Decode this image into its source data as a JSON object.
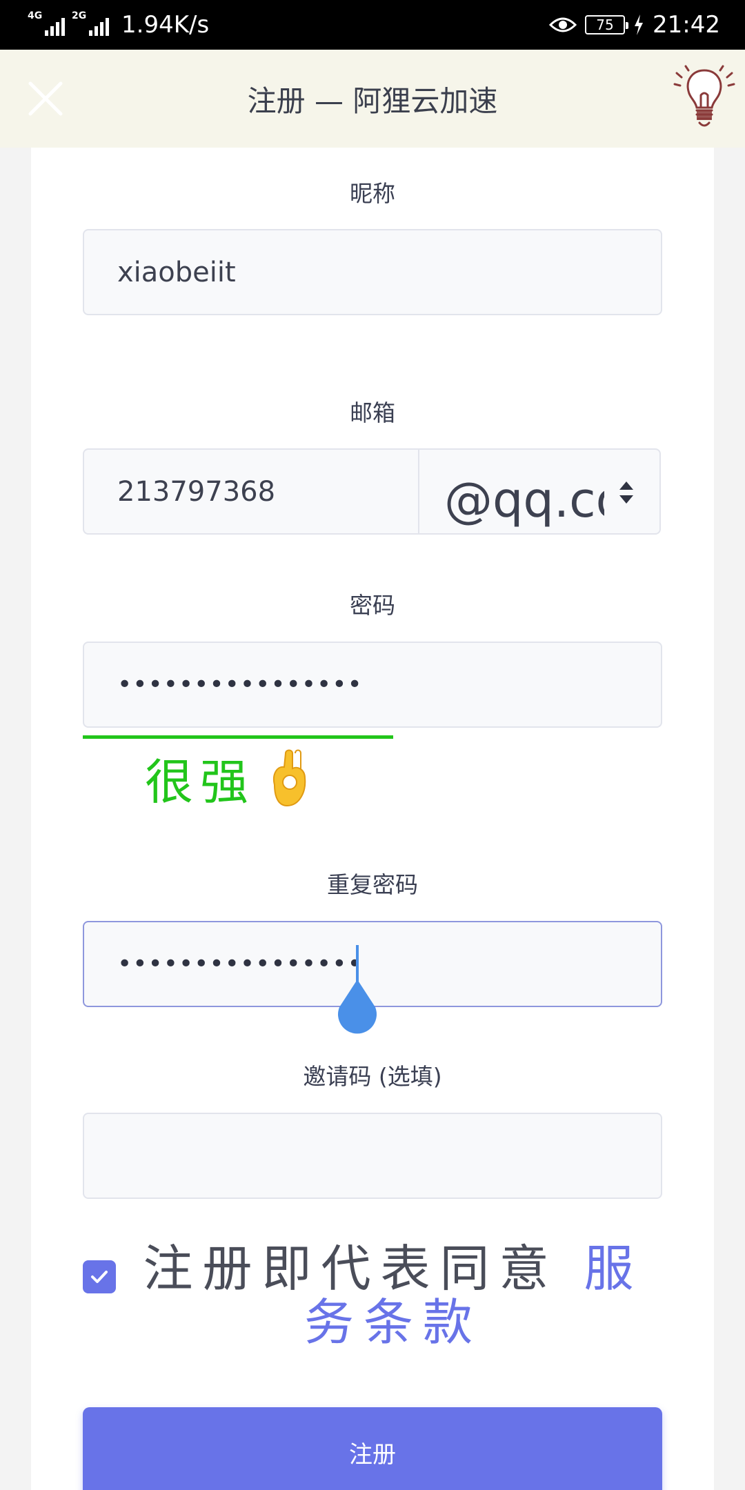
{
  "status_bar": {
    "net1": "4G",
    "net2": "2G",
    "speed": "1.94K/s",
    "battery": "75",
    "time": "21:42"
  },
  "header": {
    "title": "注册 — 阿狸云加速"
  },
  "form": {
    "nickname_label": "昵称",
    "nickname_value": "xiaobeiit",
    "email_label": "邮箱",
    "email_user": "213797368",
    "email_domain": "@qq.com",
    "password_label": "密码",
    "password_value": "••••••••••••••••",
    "strength_label": "很强",
    "repeat_label": "重复密码",
    "repeat_value": "••••••••••••••••",
    "invite_label": "邀请码 (选填)",
    "invite_value": "",
    "agree_text": "注册即代表同意",
    "agree_link": "服务条款",
    "agree_checked": true,
    "submit_label": "注册"
  },
  "colors": {
    "accent": "#6873e8",
    "strength": "#22c51b",
    "header_bg": "#f6f5ea",
    "cursor": "#4a90e8"
  }
}
